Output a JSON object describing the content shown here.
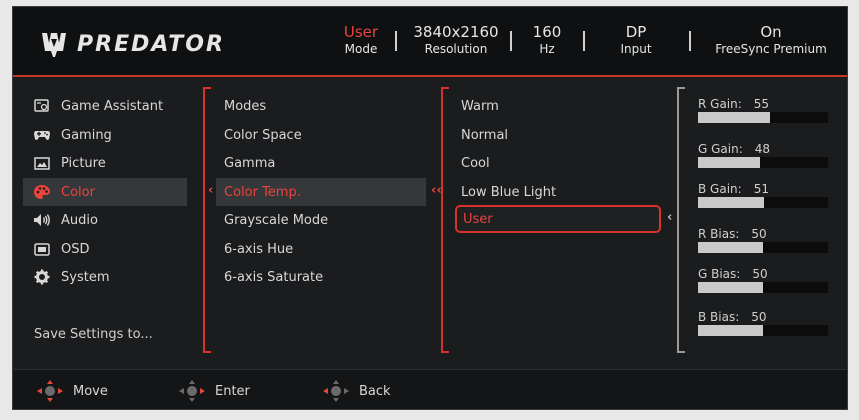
{
  "brand": {
    "name": "PREDATOR",
    "logo_icon": "predator-logo-icon"
  },
  "header": {
    "status": [
      {
        "value": "User",
        "label": "Mode",
        "value_color": "#e8453c"
      },
      {
        "value": "3840x2160",
        "label": "Resolution"
      },
      {
        "value": "160",
        "label": "Hz"
      },
      {
        "value": "DP",
        "label": "Input"
      },
      {
        "value": "On",
        "label": "FreeSync Premium"
      }
    ]
  },
  "nav": {
    "items": [
      {
        "label": "Game Assistant",
        "icon": "game-assistant-icon"
      },
      {
        "label": "Gaming",
        "icon": "gamepad-icon"
      },
      {
        "label": "Picture",
        "icon": "picture-icon"
      },
      {
        "label": "Color",
        "icon": "palette-icon",
        "active": true
      },
      {
        "label": "Audio",
        "icon": "speaker-icon"
      },
      {
        "label": "OSD",
        "icon": "osd-icon"
      },
      {
        "label": "System",
        "icon": "gear-icon"
      }
    ],
    "save_label": "Save Settings to..."
  },
  "color_menu": {
    "items": [
      "Modes",
      "Color Space",
      "Gamma",
      "Color Temp.",
      "Grayscale Mode",
      "6-axis Hue",
      "6-axis Saturate"
    ],
    "active_index": 3
  },
  "color_temp": {
    "options": [
      "Warm",
      "Normal",
      "Cool",
      "Low Blue Light",
      "User"
    ],
    "selected_index": 4
  },
  "user_settings": {
    "sliders": [
      {
        "label": "R Gain:",
        "value": "55",
        "fraction": 0.55
      },
      {
        "label": "G Gain:",
        "value": "48",
        "fraction": 0.48
      },
      {
        "label": "B Gain:",
        "value": "51",
        "fraction": 0.51
      },
      {
        "label": "R Bias:",
        "value": "50",
        "fraction": 0.5
      },
      {
        "label": "G Bias:",
        "value": "50",
        "fraction": 0.5
      },
      {
        "label": "B Bias:",
        "value": "50",
        "fraction": 0.5
      }
    ]
  },
  "footer": {
    "move_label": "Move",
    "enter_label": "Enter",
    "back_label": "Back"
  },
  "colors": {
    "accent": "#e8453c",
    "background": "#1b1c1e",
    "highlight": "#35373a"
  }
}
